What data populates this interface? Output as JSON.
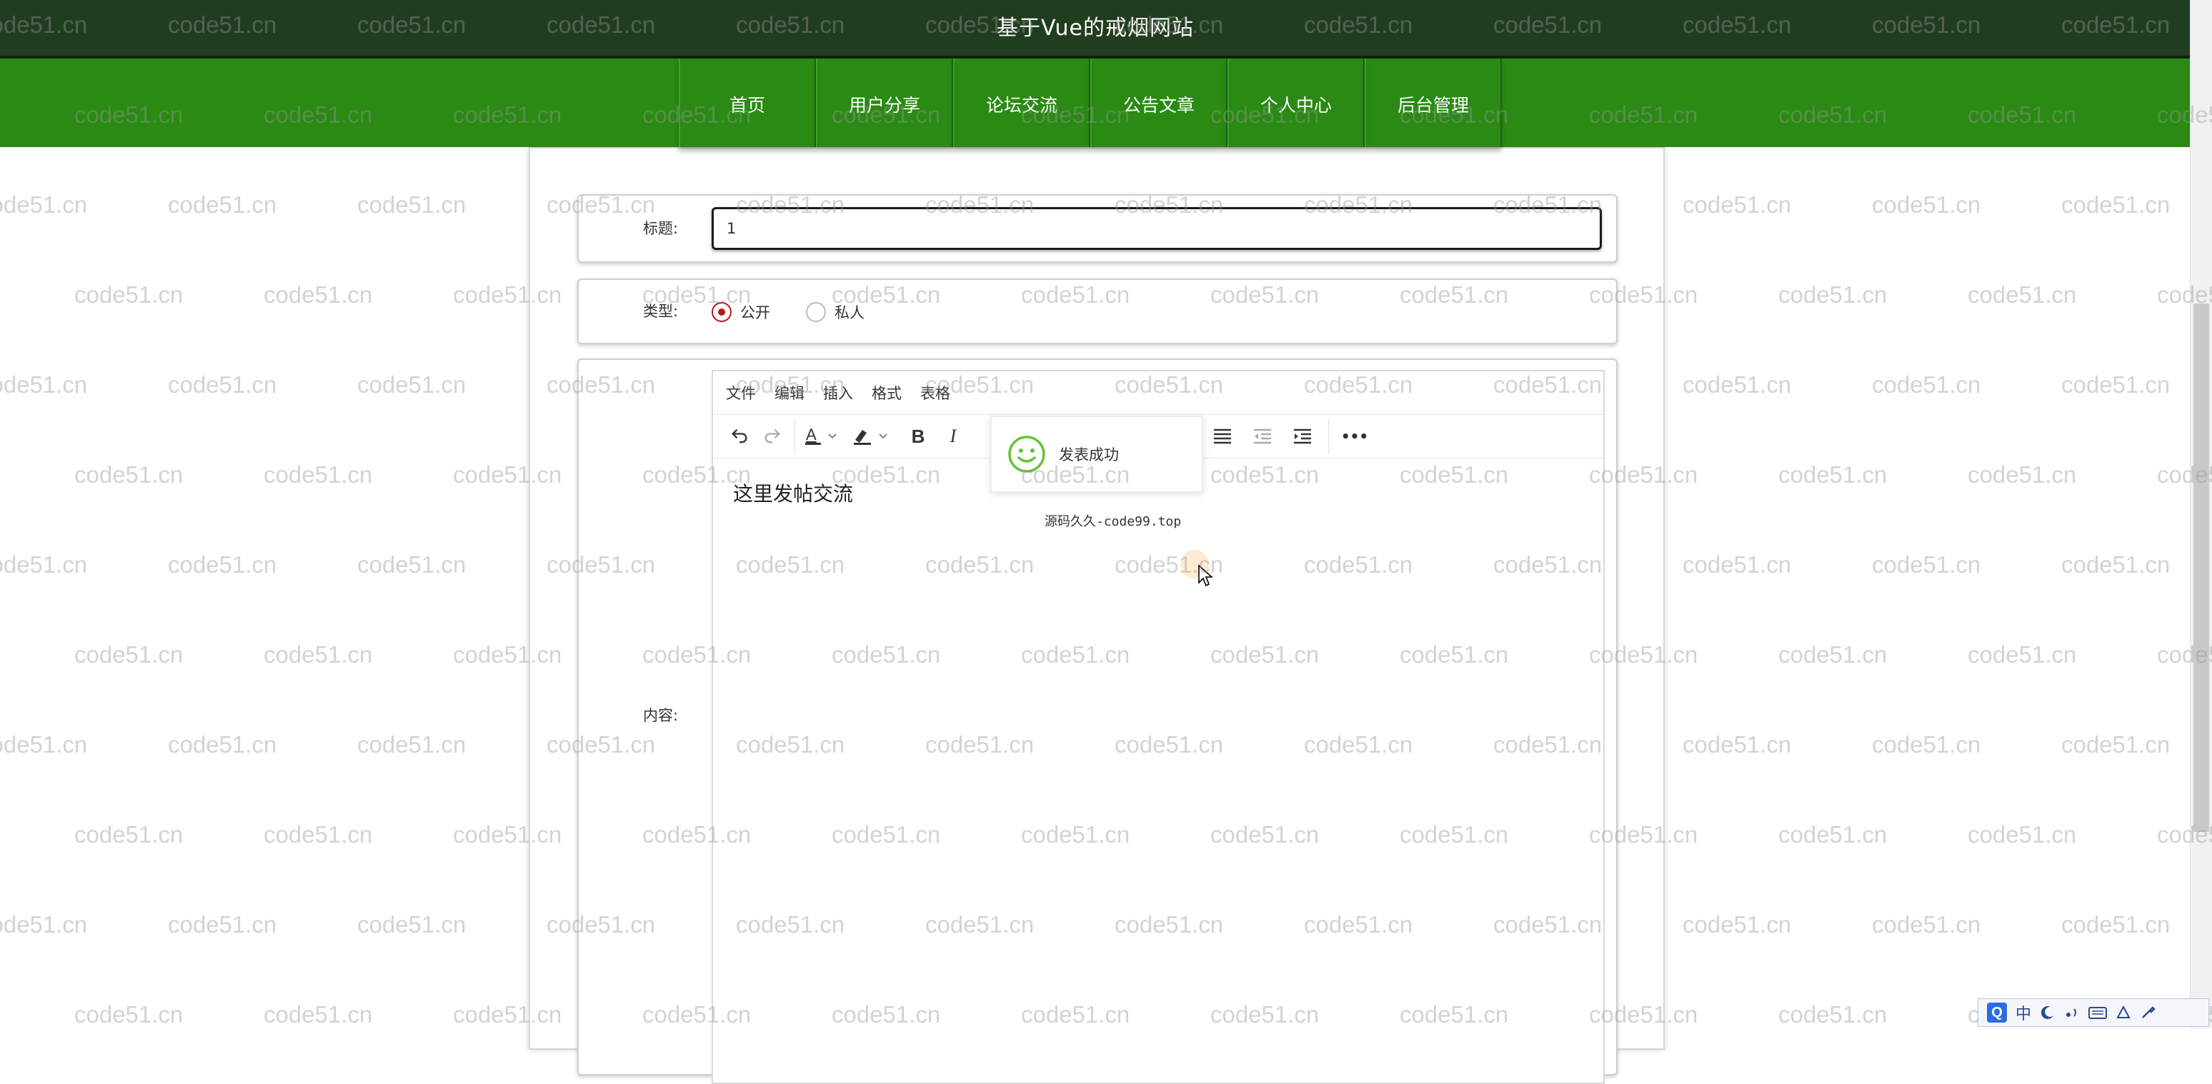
{
  "header": {
    "site_title": "基于Vue的戒烟网站"
  },
  "nav": {
    "items": [
      {
        "label": "首页",
        "name": "nav-item-home"
      },
      {
        "label": "用户分享",
        "name": "nav-item-user-share"
      },
      {
        "label": "论坛交流",
        "name": "nav-item-forum"
      },
      {
        "label": "公告文章",
        "name": "nav-item-announcements"
      },
      {
        "label": "个人中心",
        "name": "nav-item-personal-center"
      },
      {
        "label": "后台管理",
        "name": "nav-item-admin"
      }
    ]
  },
  "form": {
    "title_label": "标题:",
    "title_value": "1",
    "type_label": "类型:",
    "type_options": [
      {
        "label": "公开",
        "checked": true
      },
      {
        "label": "私人",
        "checked": false
      }
    ],
    "content_label": "内容:"
  },
  "editor": {
    "menubar": [
      "文件",
      "编辑",
      "插入",
      "格式",
      "表格"
    ],
    "toolbar_icons": [
      "undo-icon",
      "redo-icon",
      "text-color-icon",
      "highlight-color-icon",
      "bold-icon",
      "italic-icon",
      "align-right-icon",
      "align-justify-icon",
      "outdent-icon",
      "indent-icon",
      "more-icon"
    ],
    "bold_label": "B",
    "italic_label": "I",
    "more_label": "•••",
    "content": "这里发帖交流"
  },
  "toast": {
    "message": "发表成功",
    "icon": "smile-icon",
    "color": "#67c23a"
  },
  "overlay_text": "源码久久-code99.top",
  "watermark_text": "code51.cn",
  "ime": {
    "logo": "Q",
    "mode": "中"
  },
  "colors": {
    "header_bg": "#213d1f",
    "nav_bg": "#2a8a14",
    "radio_checked": "#b11c1c"
  }
}
